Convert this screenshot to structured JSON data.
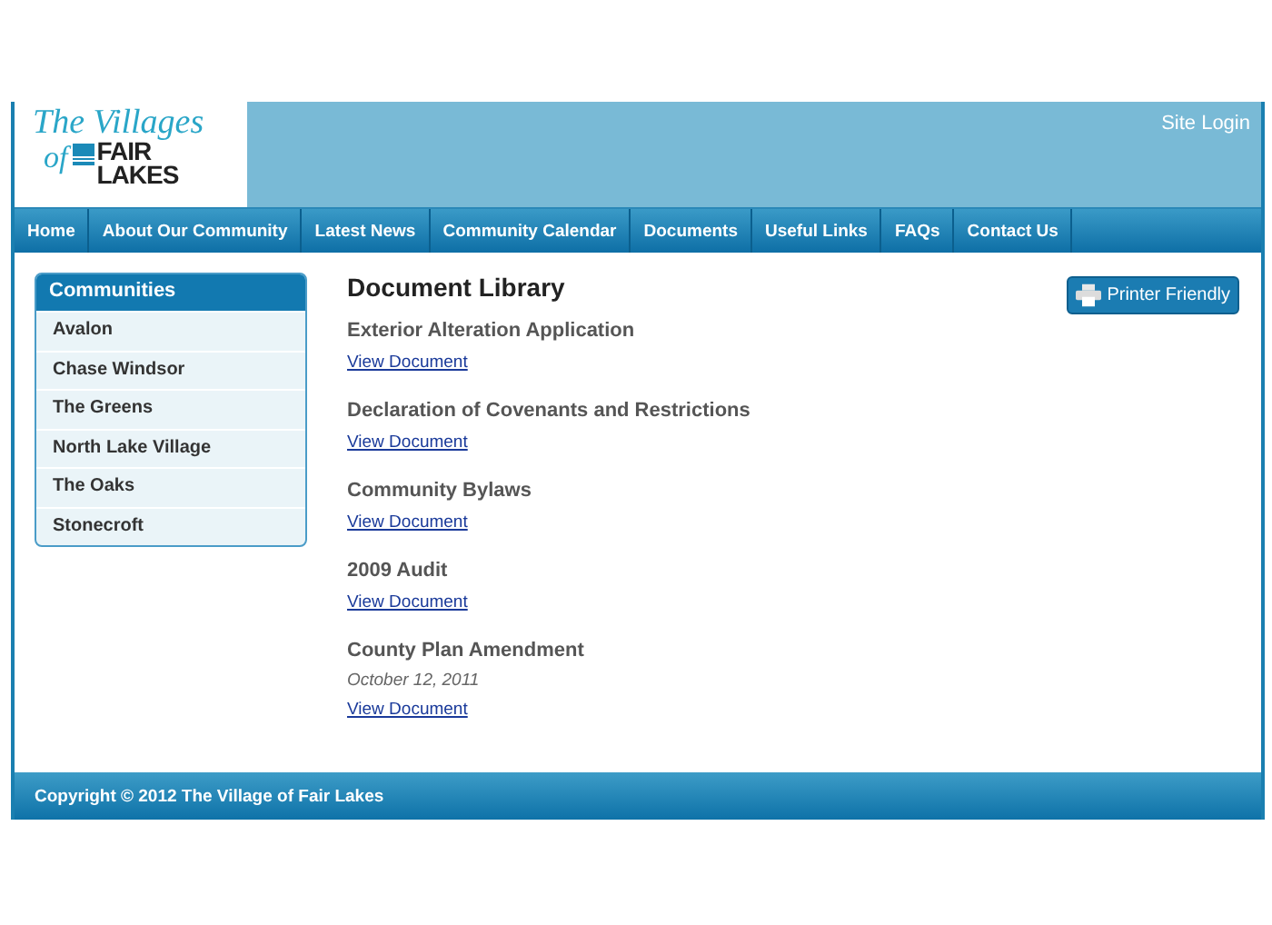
{
  "logo": {
    "script_top": "The Villages",
    "script_of": "of",
    "word_1": "FAIR",
    "word_2": "LAKES"
  },
  "site_login": "Site Login",
  "nav": [
    {
      "label": "Home"
    },
    {
      "label": "About Our Community"
    },
    {
      "label": "Latest News"
    },
    {
      "label": "Community Calendar"
    },
    {
      "label": "Documents"
    },
    {
      "label": "Useful Links"
    },
    {
      "label": "FAQs"
    },
    {
      "label": "Contact Us"
    }
  ],
  "sidebar": {
    "title": "Communities",
    "items": [
      "Avalon",
      "Chase Windsor",
      "The Greens",
      "North Lake Village",
      "The Oaks",
      "Stonecroft"
    ]
  },
  "page_title": "Document Library",
  "printer_button": "Printer Friendly",
  "documents": [
    {
      "title": "Exterior Alteration Application",
      "link": "View Document"
    },
    {
      "title": "Declaration of Covenants and Restrictions",
      "link": "View Document"
    },
    {
      "title": "Community Bylaws",
      "link": "View Document"
    },
    {
      "title": "2009 Audit",
      "link": "View Document"
    },
    {
      "title": "County Plan Amendment",
      "date": "October 12, 2011",
      "link": "View Document"
    }
  ],
  "footer": "Copyright © 2012 The Village of Fair Lakes"
}
